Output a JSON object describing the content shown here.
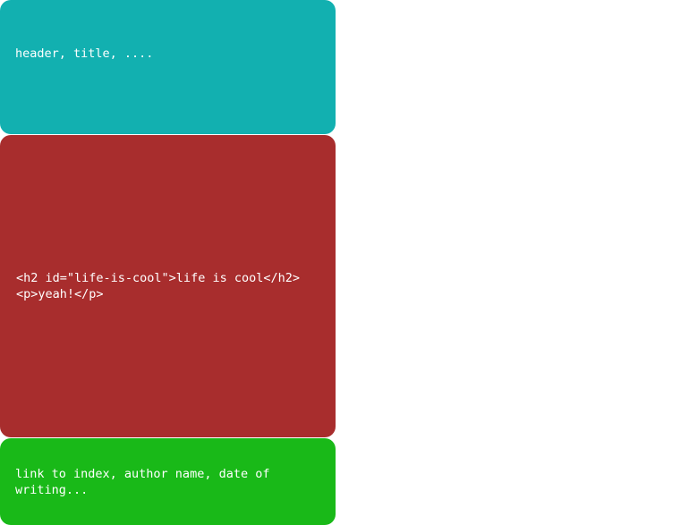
{
  "header": {
    "text": "header, title, ...."
  },
  "main": {
    "lines": [
      "<h2 id=\"life-is-cool\">life is cool</h2>",
      "<p>yeah!</p>"
    ]
  },
  "footer": {
    "text": "link to index, author name, date of writing..."
  },
  "colors": {
    "header_bg": "#12b0b0",
    "main_bg": "#a82d2d",
    "footer_bg": "#19b918"
  }
}
